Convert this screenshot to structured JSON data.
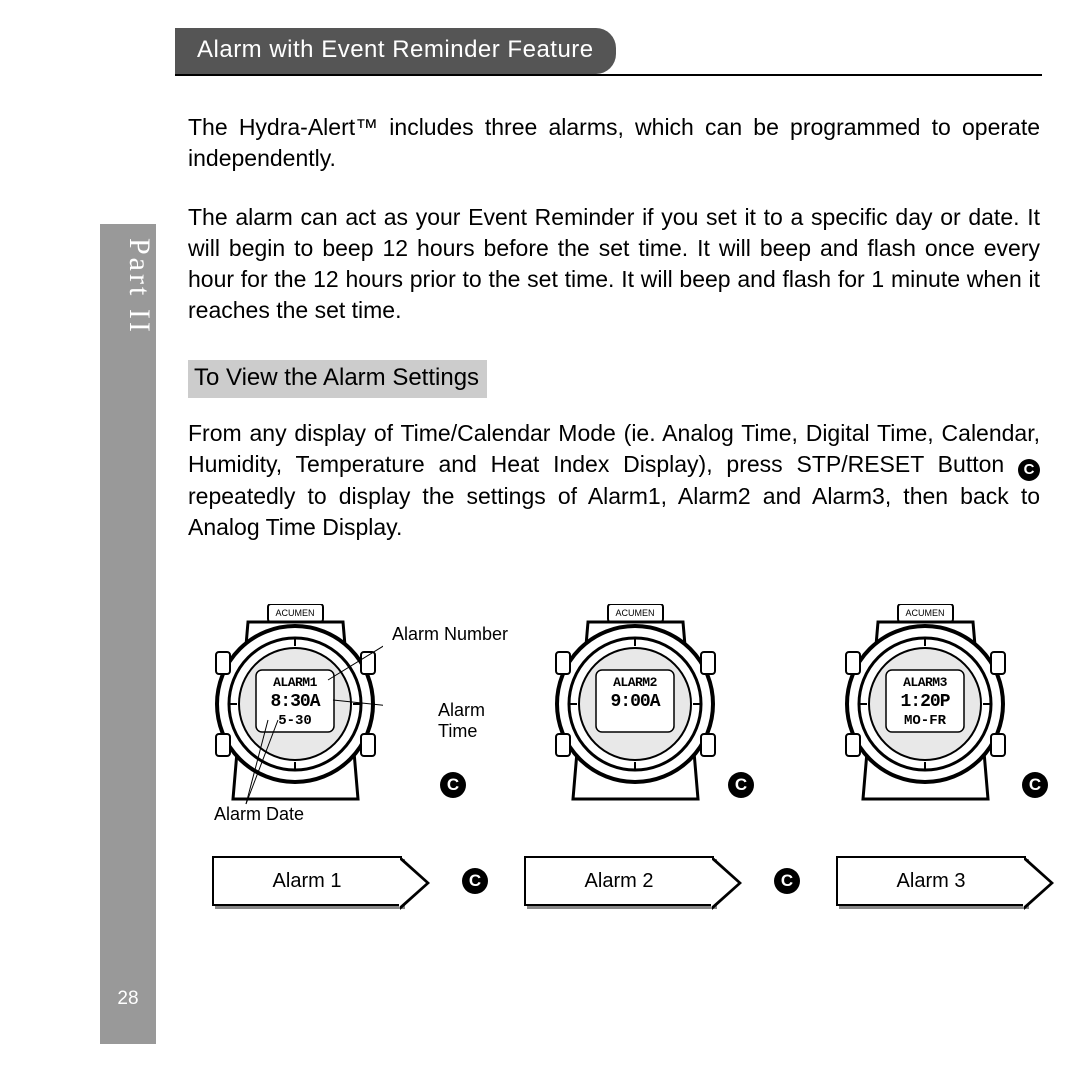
{
  "side": {
    "label": "Part II",
    "page": "28"
  },
  "header": {
    "title": "Alarm with Event Reminder Feature"
  },
  "body": {
    "p1": "The Hydra-Alert™  includes three alarms, which can be programmed to operate independently.",
    "p2": "The alarm can act as your Event Reminder if you set it to a specific day or date. It will begin to beep 12 hours before the set time. It will beep and flash once every hour for the 12 hours prior to the set time. It will beep and flash for 1 minute when it reaches the set time.",
    "sub": "To View the Alarm Settings",
    "p3a": "From any display of Time/Calendar Mode (ie. Analog Time, Digital Time, Calendar, Humidity, Temperature and Heat Index Display), press STP/RESET Button ",
    "p3b": " repeatedly to display the settings of Alarm1, Alarm2 and Alarm3, then back to Analog Time Display."
  },
  "button_c": "C",
  "callouts": {
    "alarm_number": "Alarm Number",
    "alarm_time": "Alarm\nTime",
    "alarm_date": "Alarm Date"
  },
  "watches": {
    "brand": "ACUMEN",
    "w1": {
      "top": "ALARM1",
      "mid": "8:30A",
      "bot": "5-30",
      "label": "Alarm 1"
    },
    "w2": {
      "top": "ALARM2",
      "mid": "9:00A",
      "bot": "",
      "label": "Alarm 2"
    },
    "w3": {
      "top": "ALARM3",
      "mid": "1:20P",
      "bot": "MO-FR",
      "label": "Alarm 3"
    }
  }
}
